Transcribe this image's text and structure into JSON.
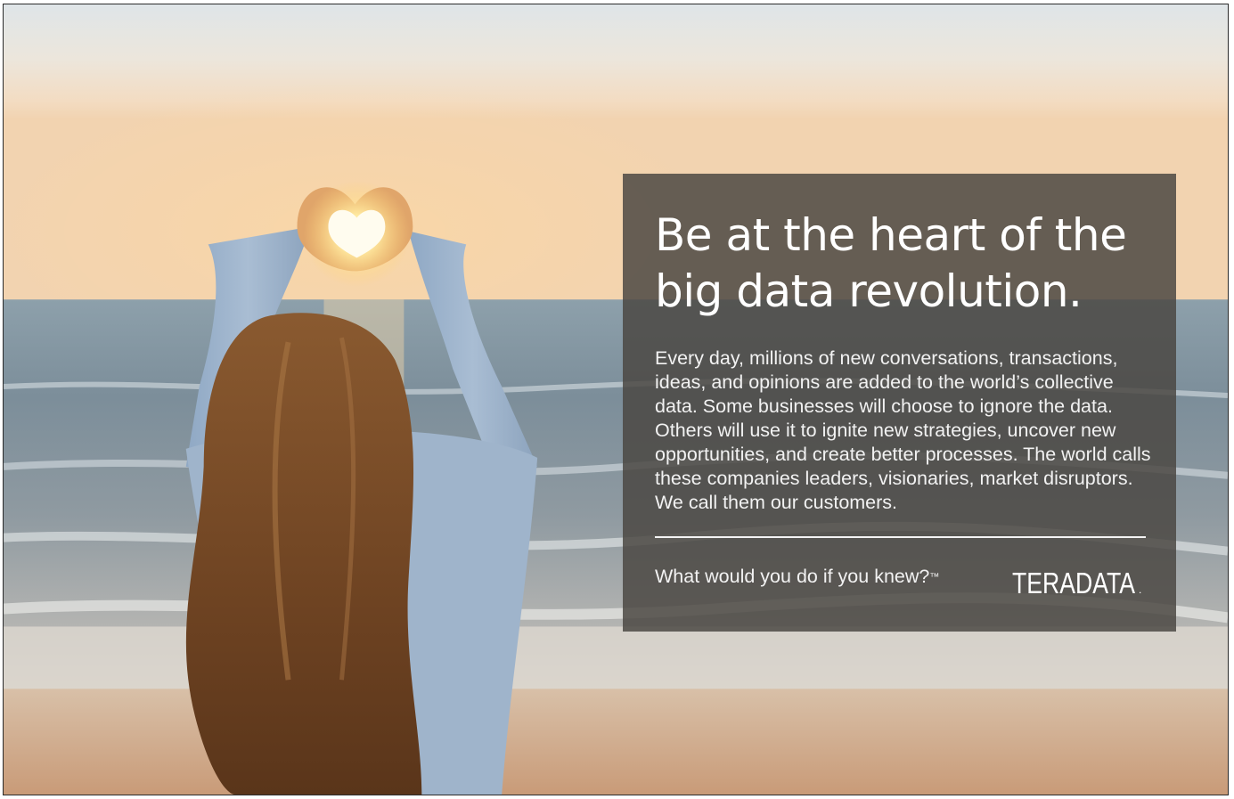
{
  "ad": {
    "headline_line1": "Be at the heart of the",
    "headline_line2": "big data revolution.",
    "body": "Every day, millions of new conversations, transactions, ideas, and opinions are added to the world’s collective data. Some businesses will choose to ignore the data. Others will use it to ignite new strategies, uncover new opportunities, and create better processes. The world calls these companies leaders, visionaries, market disruptors. We call them our customers.",
    "tagline": "What would you do if you knew?",
    "tagline_mark": "™",
    "logo_text": "TERADATA",
    "logo_mark": "."
  },
  "photo": {
    "subject": "woman-making-heart-hands-at-sunset-beach-icon"
  },
  "colors": {
    "panel": "#4a4642",
    "text": "#ffffff"
  }
}
